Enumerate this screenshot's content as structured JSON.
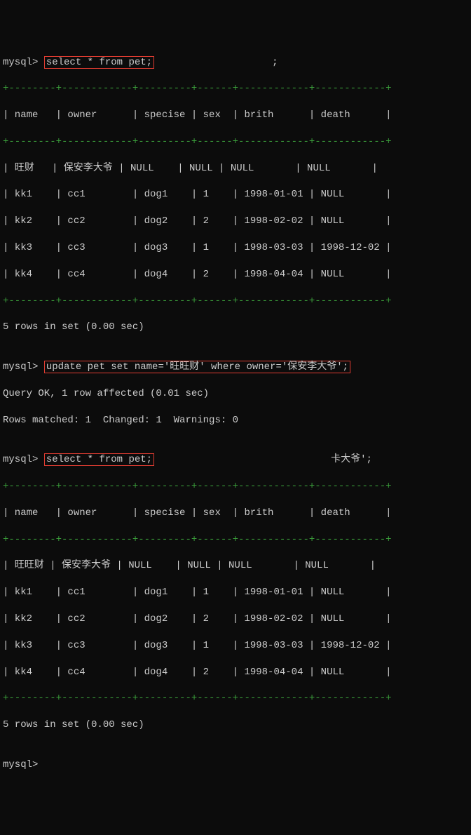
{
  "prompt": "mysql>",
  "q1": "select * from pet;",
  "q1_trailing": ";",
  "q2": "update pet set name='旺旺财' where owner='保安李大爷';",
  "q3": "select * from pet;",
  "q3_trailing": "卡大爷';",
  "result1": {
    "sep": "+--------+------------+---------+------+------------+------------+",
    "hdr": "| name   | owner      | specise | sex  | brith      | death      |",
    "r0": "| 旺财   | 保安李大爷 | NULL    | NULL | NULL       | NULL       |",
    "r1": "| kk1    | cc1        | dog1    | 1    | 1998-01-01 | NULL       |",
    "r2": "| kk2    | cc2        | dog2    | 2    | 1998-02-02 | NULL       |",
    "r3": "| kk3    | cc3        | dog3    | 1    | 1998-03-03 | 1998-12-02 |",
    "r4": "| kk4    | cc4        | dog4    | 2    | 1998-04-04 | NULL       |",
    "footer": "5 rows in set (0.00 sec)"
  },
  "update_result": {
    "line1": "Query OK, 1 row affected (0.01 sec)",
    "line2": "Rows matched: 1  Changed: 1  Warnings: 0"
  },
  "result2": {
    "sep": "+--------+------------+---------+------+------------+------------+",
    "hdr": "| name   | owner      | specise | sex  | brith      | death      |",
    "r0": "| 旺旺财 | 保安李大爷 | NULL    | NULL | NULL       | NULL       |",
    "r1": "| kk1    | cc1        | dog1    | 1    | 1998-01-01 | NULL       |",
    "r2": "| kk2    | cc2        | dog2    | 2    | 1998-02-02 | NULL       |",
    "r3": "| kk3    | cc3        | dog3    | 1    | 1998-03-03 | 1998-12-02 |",
    "r4": "| kk4    | cc4        | dog4    | 2    | 1998-04-04 | NULL       |",
    "footer": "5 rows in set (0.00 sec)"
  },
  "blank": ""
}
